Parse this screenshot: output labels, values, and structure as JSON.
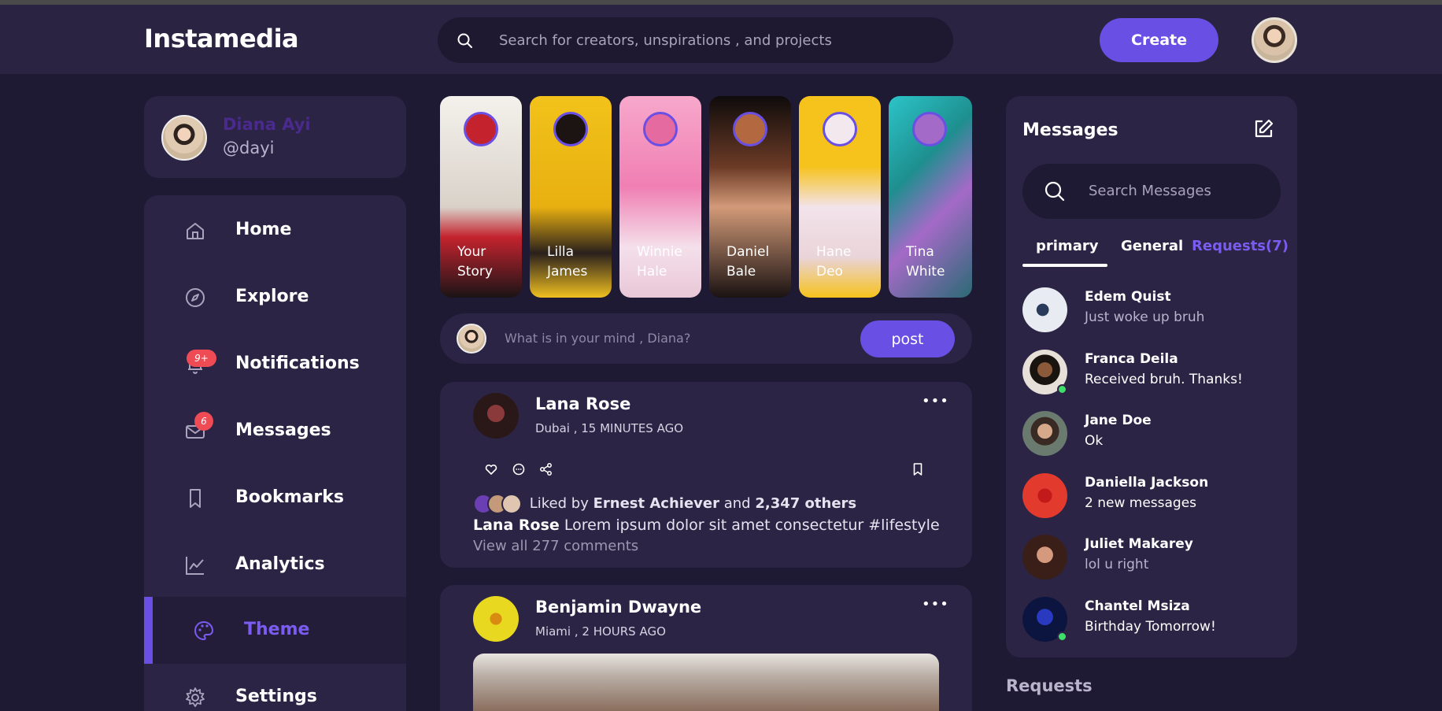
{
  "app": {
    "name": "Instamedia"
  },
  "search": {
    "placeholder": "Search for creators, unspirations , and projects"
  },
  "header": {
    "create_label": "Create"
  },
  "profile": {
    "name": "Diana Ayi",
    "handle": "@dayi"
  },
  "sidebar": {
    "items": [
      {
        "label": "Home",
        "icon": "home-icon"
      },
      {
        "label": "Explore",
        "icon": "compass-icon"
      },
      {
        "label": "Notifications",
        "icon": "bell-icon",
        "badge": "9+"
      },
      {
        "label": "Messages",
        "icon": "mail-icon",
        "badge": "6"
      },
      {
        "label": "Bookmarks",
        "icon": "bookmark-icon"
      },
      {
        "label": "Analytics",
        "icon": "chart-icon"
      },
      {
        "label": "Theme",
        "icon": "palette-icon",
        "active": true
      },
      {
        "label": "Settings",
        "icon": "gear-icon"
      }
    ]
  },
  "stories": [
    {
      "name": "Your Story",
      "bg": "#e9e4dd",
      "accent": "#c4232e"
    },
    {
      "name": "Lilla James",
      "bg": "#f2c21a",
      "accent": "#1c1412"
    },
    {
      "name": "Winnie Hale",
      "bg": "#f29ac0",
      "accent": "#e46aa0"
    },
    {
      "name": "Daniel Bale",
      "bg": "#141010",
      "accent": "#b4683f"
    },
    {
      "name": "Hane Deo",
      "bg": "#f6c21c",
      "accent": "#f4e8ef"
    },
    {
      "name": "Tina White",
      "bg": "#1e8f8f",
      "accent": "#a46ac7"
    }
  ],
  "compose": {
    "placeholder": "What is in your mind , Diana?",
    "post_label": "post"
  },
  "posts": [
    {
      "author": "Lana Rose",
      "location": "Dubai , 15 MINUTES AGO",
      "liked_prefix": "Liked by",
      "liked_user": "Ernest Achiever",
      "liked_and": "and",
      "liked_count": "2,347 others",
      "caption": "Lorem ipsum dolor sit amet consectetur #lifestyle",
      "view_comments": "View all 277 comments"
    },
    {
      "author": "Benjamin Dwayne",
      "location": "Miami , 2 HOURS AGO"
    }
  ],
  "messages": {
    "title": "Messages",
    "search_placeholder": "Search Messages",
    "tabs": [
      "primary",
      "General",
      "Requests(7)"
    ],
    "items": [
      {
        "name": "Edem Quist",
        "text": "Just woke up bruh",
        "online": false,
        "dim": true
      },
      {
        "name": "Franca Deila",
        "text": "Received bruh. Thanks!",
        "online": true,
        "dim": false
      },
      {
        "name": "Jane Doe",
        "text": "Ok",
        "online": false,
        "dim": false
      },
      {
        "name": "Daniella Jackson",
        "text": "2 new messages",
        "online": false,
        "dim": false
      },
      {
        "name": "Juliet Makarey",
        "text": "lol u right",
        "online": false,
        "dim": true
      },
      {
        "name": "Chantel Msiza",
        "text": "Birthday Tomorrow!",
        "online": true,
        "dim": false
      }
    ]
  },
  "requests": {
    "title": "Requests"
  },
  "colors": {
    "accent": "#6a4fe4",
    "background": "#1f1a33",
    "card": "#2b2444",
    "badge": "#ee4b55"
  }
}
